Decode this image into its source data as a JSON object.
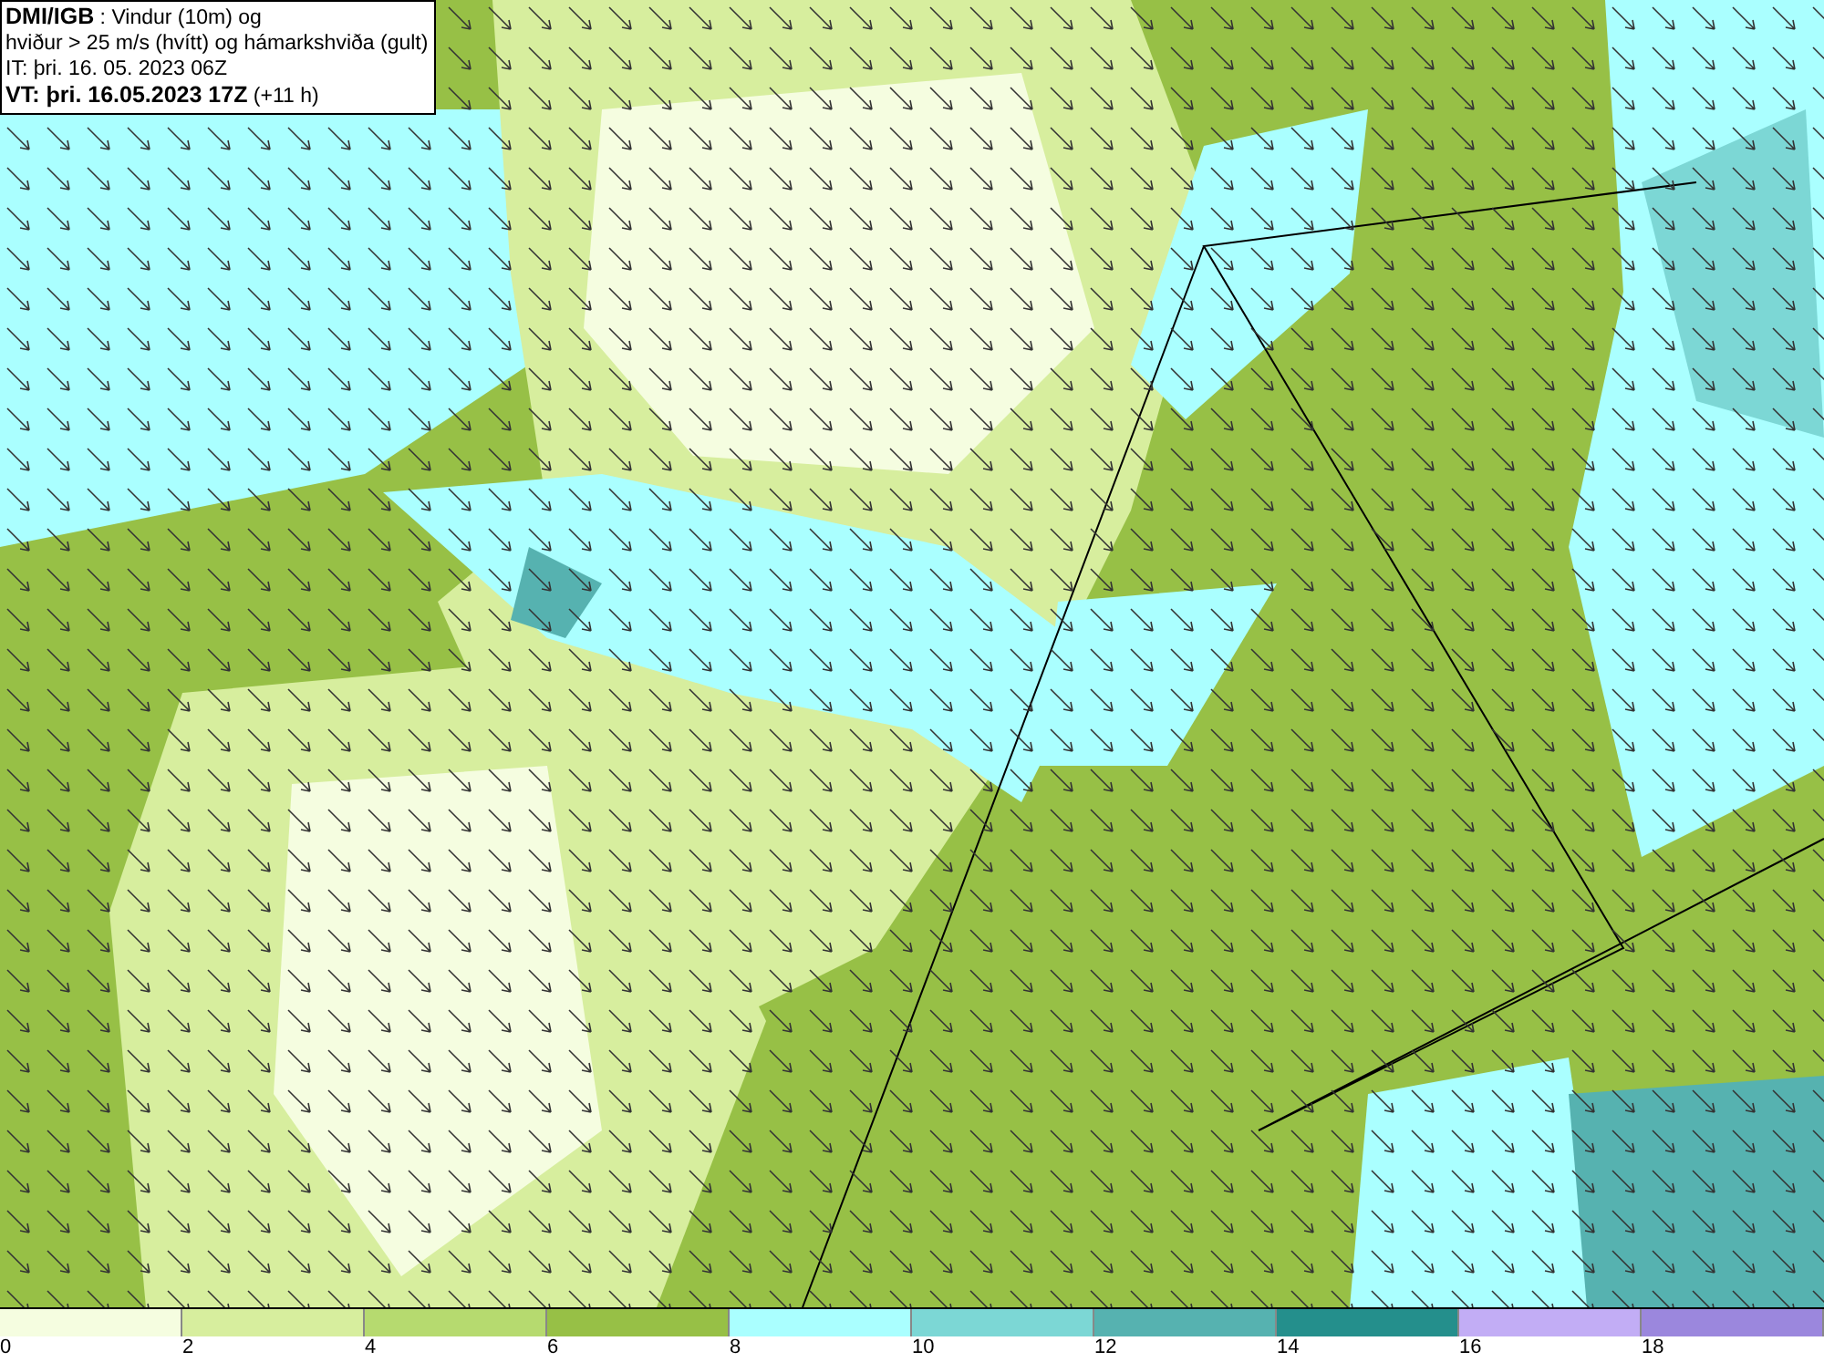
{
  "header": {
    "lines": [
      "**DMI/IGB** : Vindur (10m) og",
      "hviður > 25 m/s (hvítt) og hámarkshviða (gult)",
      "IT: þri. 16. 05. 2023 06Z",
      "**VT: þri. 16.05.2023 17Z** (+11 h)"
    ]
  },
  "legend": [
    {
      "label": "0",
      "color": "#f5fde0"
    },
    {
      "label": "2",
      "color": "#d7ee9e"
    },
    {
      "label": "4",
      "color": "#b6da6f"
    },
    {
      "label": "6",
      "color": "#97c046"
    },
    {
      "label": "8",
      "color": "#aaffff"
    },
    {
      "label": "10",
      "color": "#7cd7d5"
    },
    {
      "label": "12",
      "color": "#56b2b0"
    },
    {
      "label": "14",
      "color": "#248f8c"
    },
    {
      "label": "16",
      "color": "#c2adf5"
    },
    {
      "label": "18",
      "color": "#9b87dd"
    }
  ]
}
